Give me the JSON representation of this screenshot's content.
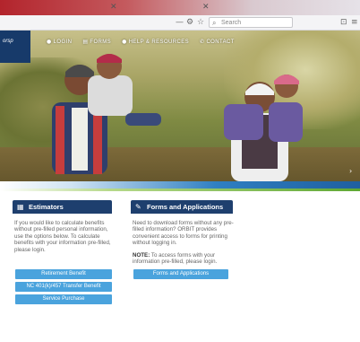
{
  "browser": {
    "url_placeholder": "Search",
    "icons": [
      "close-icon",
      "minimize-icon",
      "gear-icon",
      "star-icon",
      "search-icon",
      "menu-icon"
    ]
  },
  "site": {
    "logo_text": "orsp",
    "nav": [
      {
        "label": "LOGIN",
        "icon": "user-icon"
      },
      {
        "label": "FORMS",
        "icon": "document-icon"
      },
      {
        "label": "HELP & RESOURCES",
        "icon": "help-icon"
      },
      {
        "label": "CONTACT",
        "icon": "phone-icon"
      }
    ]
  },
  "estimators": {
    "title": "Estimators",
    "icon": "calculator-icon",
    "body": "If you would like to calculate benefits without pre-filled personal information, use the options below. To calculate benefits with your information pre-filled, please login.",
    "buttons": [
      "Retirement Benefit",
      "NC 401(k)/457 Transfer Benefit",
      "Service Purchase"
    ]
  },
  "forms": {
    "title": "Forms and Applications",
    "icon": "edit-icon",
    "body": "Need to download forms without any pre-filled information? ORBIT provides convenient access to forms for printing without logging in.",
    "note_label": "NOTE:",
    "note_text": "To access forms with your information pre-filled, please login.",
    "button": "Forms and Applications"
  },
  "colors": {
    "header_navy": "#1e3f6e",
    "button_blue": "#4aa3dd",
    "stripe_blue": "#2f7fc2",
    "stripe_green": "#5fa833"
  }
}
